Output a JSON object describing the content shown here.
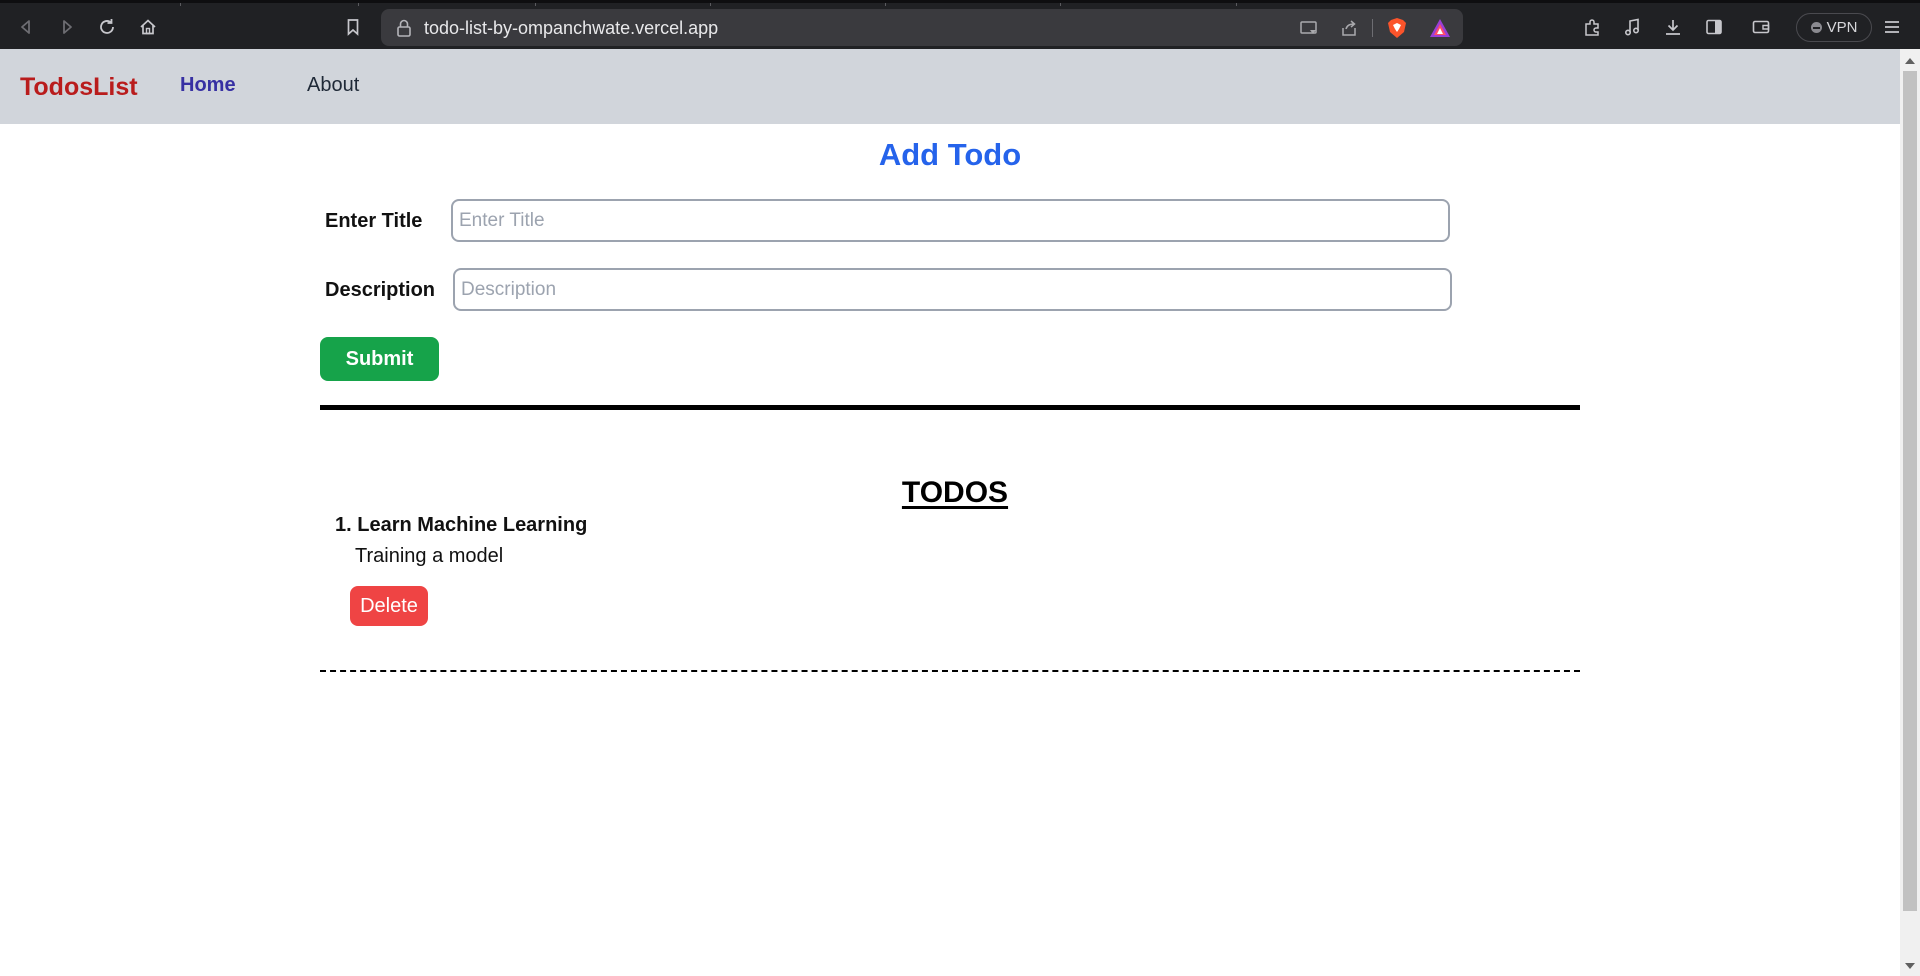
{
  "browser": {
    "url": "todo-list-by-ompanchwate.vercel.app",
    "vpn_label": "VPN",
    "icons": {
      "back": "back-arrow-icon",
      "forward": "forward-arrow-icon",
      "reload": "reload-icon",
      "home": "home-icon",
      "bookmark": "bookmark-icon",
      "lock": "lock-icon",
      "cast": "cast-icon",
      "share": "share-icon",
      "brave": "brave-shields-icon",
      "rewards": "brave-rewards-icon",
      "extensions": "extensions-icon",
      "media": "music-note-icon",
      "downloads": "download-icon",
      "sidebar": "sidebar-icon",
      "wallet": "wallet-icon",
      "menu": "hamburger-menu-icon"
    }
  },
  "navbar": {
    "brand": "TodosList",
    "links": [
      {
        "label": "Home",
        "active": true
      },
      {
        "label": "About",
        "active": false
      }
    ],
    "background": "#d1d5db",
    "brand_color": "#b91c1c",
    "active_color": "#3730a3"
  },
  "add_todo": {
    "heading": "Add Todo",
    "title_label": "Enter Title",
    "title_placeholder": "Enter Title",
    "title_value": "",
    "description_label": "Description",
    "description_placeholder": "Description",
    "description_value": "",
    "submit_label": "Submit",
    "heading_color": "#2563eb",
    "submit_color": "#16a34a"
  },
  "todos": {
    "heading": "TODOS",
    "items": [
      {
        "number": "1.",
        "title": "Learn Machine Learning",
        "description": "Training a model",
        "delete_label": "Delete"
      }
    ],
    "delete_color": "#ef4444"
  }
}
